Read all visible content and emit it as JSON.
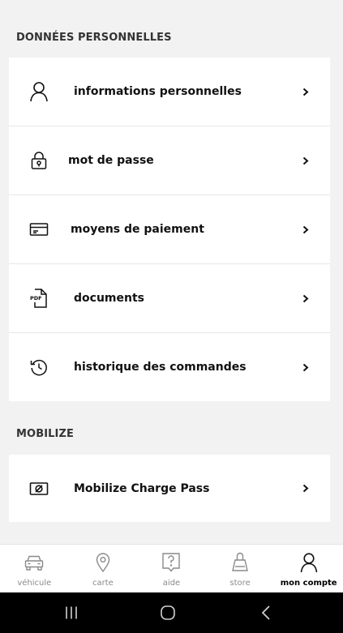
{
  "sections": [
    {
      "title": "DONNÉES PERSONNELLES",
      "items": [
        {
          "label": "informations personnelles",
          "icon": "user-icon"
        },
        {
          "label": "mot de passe",
          "icon": "lock-icon"
        },
        {
          "label": "moyens de paiement",
          "icon": "credit-card-icon"
        },
        {
          "label": "documents",
          "icon": "pdf-document-icon"
        },
        {
          "label": "historique des commandes",
          "icon": "history-icon"
        }
      ]
    },
    {
      "title": "MOBILIZE",
      "items": [
        {
          "label": "Mobilize Charge Pass",
          "icon": "charge-pass-icon"
        }
      ]
    }
  ],
  "tabbar": {
    "active": "mon compte",
    "tabs": [
      {
        "label": "véhicule",
        "icon": "car-icon"
      },
      {
        "label": "carte",
        "icon": "map-pin-icon"
      },
      {
        "label": "aide",
        "icon": "help-icon"
      },
      {
        "label": "store",
        "icon": "shopping-bag-icon"
      },
      {
        "label": "mon compte",
        "icon": "user-icon"
      }
    ]
  },
  "colors": {
    "background": "#f2f2f2",
    "card": "#ffffff",
    "text": "#111111",
    "inactive_tab": "#8a8a8a",
    "system_nav": "#000000"
  }
}
